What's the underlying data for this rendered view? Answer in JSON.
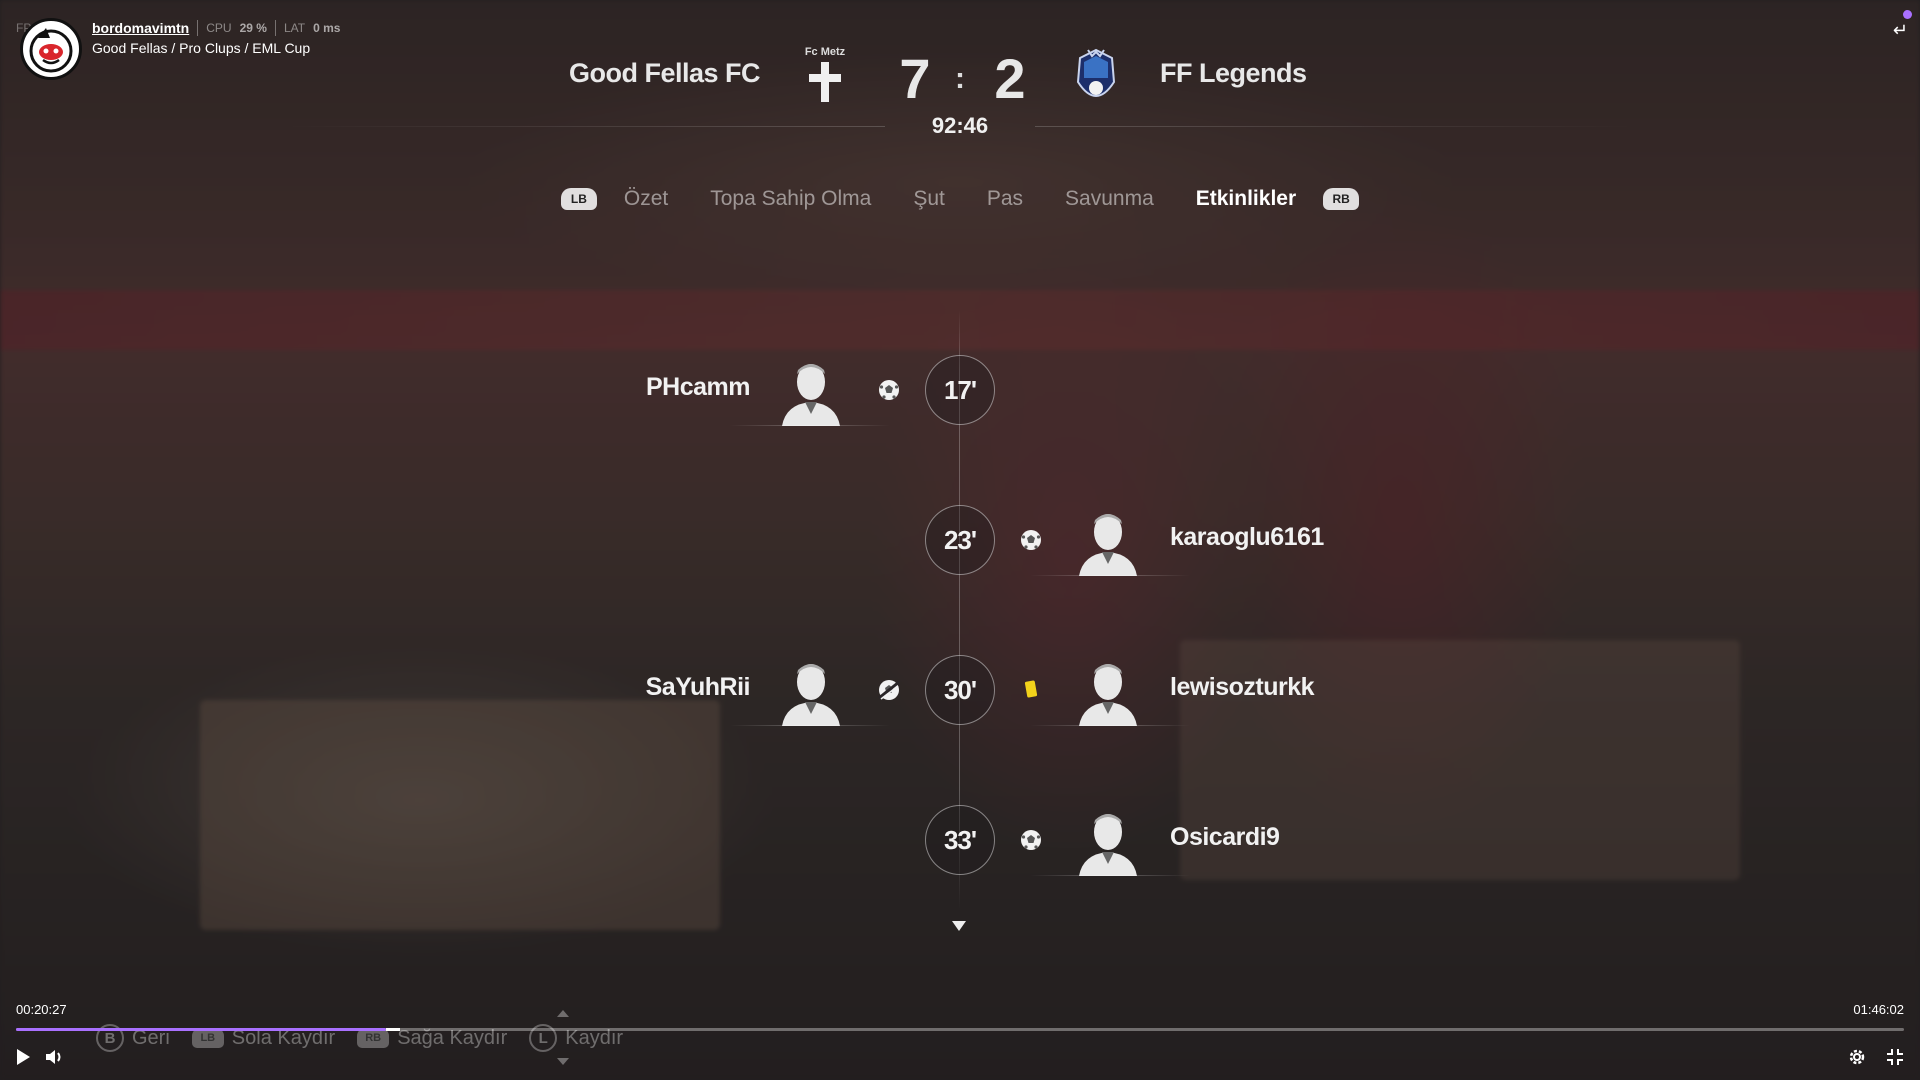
{
  "stream": {
    "fps_label": "FP",
    "username": "bordomavimtn",
    "cpu_label": "CPU",
    "cpu_value": "29 %",
    "lat_label": "LAT",
    "lat_value": "0 ms",
    "category": "Good Fellas / Pro Clups / EML Cup"
  },
  "scoreboard": {
    "home_team": "Good Fellas  FC",
    "home_crest_name": "Fc Metz",
    "home_score": "7",
    "separator": ":",
    "away_score": "2",
    "away_team": "FF Legends",
    "clock": "92:46"
  },
  "tabs": {
    "left_bumper": "LB",
    "right_bumper": "RB",
    "items": [
      "Özet",
      "Topa Sahip Olma",
      "Şut",
      "Pas",
      "Savunma",
      "Etkinlikler"
    ],
    "active": "Etkinlikler"
  },
  "events": [
    {
      "minute": "17'",
      "side": "home",
      "player": "PHcamm",
      "type": "goal"
    },
    {
      "minute": "23'",
      "side": "away",
      "player": "karaoglu6161",
      "type": "goal"
    },
    {
      "minute": "30'",
      "side": "home",
      "player": "SaYuhRii",
      "type": "assist"
    },
    {
      "minute": "30'",
      "side": "away",
      "player": "lewisozturkk",
      "type": "yellow-card"
    },
    {
      "minute": "33'",
      "side": "away",
      "player": "Osicardi9",
      "type": "goal"
    }
  ],
  "player_bar": {
    "current_time": "00:20:27",
    "total_time": "01:46:02",
    "progress": 0.196,
    "accent": "#a970ff"
  },
  "hints": {
    "back_button": "B",
    "back_label": "Geri",
    "left_button": "LB",
    "left_label": "Sola Kaydır",
    "right_button": "RB",
    "right_label": "Sağa Kaydır",
    "scroll_button": "L",
    "scroll_label": "Kaydır"
  },
  "colors": {
    "yellow_card": "#f2d21b",
    "accent": "#a970ff"
  }
}
